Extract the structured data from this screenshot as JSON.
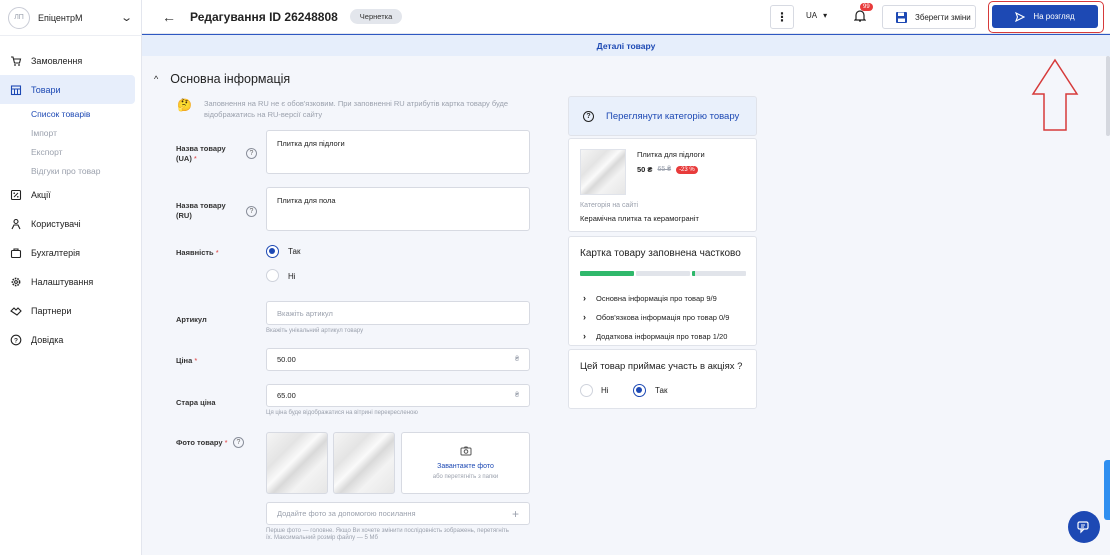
{
  "brand": {
    "avatar": "ЛП",
    "name": "ЕпіцентрМ"
  },
  "nav": [
    {
      "label": "Замовлення",
      "icon": "cart-icon"
    },
    {
      "label": "Товари",
      "icon": "store-icon",
      "active": true
    },
    {
      "label": "Акції",
      "icon": "promo-icon"
    },
    {
      "label": "Користувачі",
      "icon": "users-icon"
    },
    {
      "label": "Бухгалтерія",
      "icon": "accounting-icon"
    },
    {
      "label": "Налаштування",
      "icon": "gear-icon"
    },
    {
      "label": "Партнери",
      "icon": "handshake-icon"
    },
    {
      "label": "Довідка",
      "icon": "help-icon"
    }
  ],
  "subnav": [
    "Список товарів",
    "Імпорт",
    "Експорт",
    "Відгуки про товар"
  ],
  "header": {
    "title": "Редагування ID 26248808",
    "status": "Чернетка",
    "lang": "UA",
    "notifications": "99",
    "save": "Зберегти зміни",
    "review": "На розгляд"
  },
  "tab": "Деталі товару",
  "section": "Основна інформація",
  "note": "Заповнення на RU не є обов'язковим. При заповненні RU атрибутів картка товару буде відображатись на RU-версії сайту",
  "form": {
    "name_ua_label": "Назва товару (UA)",
    "name_ua": "Плитка для підлоги",
    "name_ru_label": "Назва товару (RU)",
    "name_ru": "Плитка для пола",
    "availability_label": "Наявність",
    "yes": "Так",
    "no": "Ні",
    "sku_label": "Артикул",
    "sku_placeholder": "Вкажіть артикул",
    "sku_hint": "Вкажіть унікальний артикул товару",
    "price_label": "Ціна",
    "price": "50.00",
    "currency": "₴",
    "old_price_label": "Стара ціна",
    "old_price": "65.00",
    "old_price_hint": "Ця ціна буде відображатися на вітрині перекресленою",
    "photo_label": "Фото товару",
    "upload_label": "Завантажте фото",
    "upload_hint": "або перетягніть з папки",
    "url_placeholder": "Додайте фото за допомогою посилання",
    "photo_hint": "Перше фото — головне. Якщо Ви хочете змінити послідовність зображень, перетягніть їх. Максимальний розмір файлу — 5 Мб"
  },
  "panel": {
    "category_link": "Переглянути категорію товару",
    "product_name": "Плитка для підлоги",
    "product_price": "50 ₴",
    "product_old_price": "65 ₴",
    "discount": "-23 %",
    "category_caption": "Категорія на сайті",
    "category": "Керамічна плитка та керамограніт",
    "fill_title": "Картка товару заповнена частково",
    "fill_progress": [
      1,
      0,
      0.06
    ],
    "checks": [
      "Основна інформація про товар 9/9",
      "Обов'язкова інформація про товар 0/9",
      "Додаткова інформація про товар 1/20"
    ],
    "promo_title": "Цей товар приймає участь в акціях ?",
    "promo_no": "Ні",
    "promo_yes": "Так"
  },
  "colors": {
    "primary": "#1d49b4",
    "accent_green": "#2fb86b",
    "danger": "#e83b3b"
  }
}
